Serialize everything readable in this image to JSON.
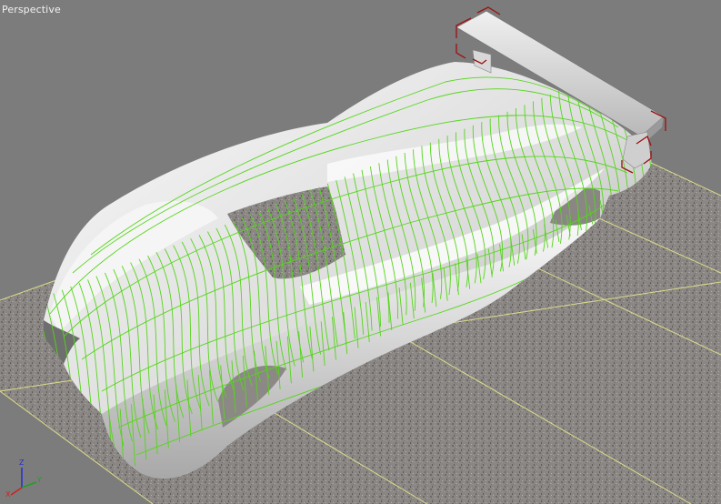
{
  "viewport": {
    "label": "Perspective",
    "background": "#7c7c7c"
  },
  "scene": {
    "wireframe_color": "#55d51a",
    "selection_color": "#9b1010",
    "ground_grid_color": "#e0e090",
    "body_color": "#e6e6e6"
  },
  "gizmo": {
    "x_axis": "X",
    "y_axis": "Y",
    "z_axis": "Z",
    "x_color": "#d02020",
    "y_color": "#20a020",
    "z_color": "#2030d0"
  }
}
